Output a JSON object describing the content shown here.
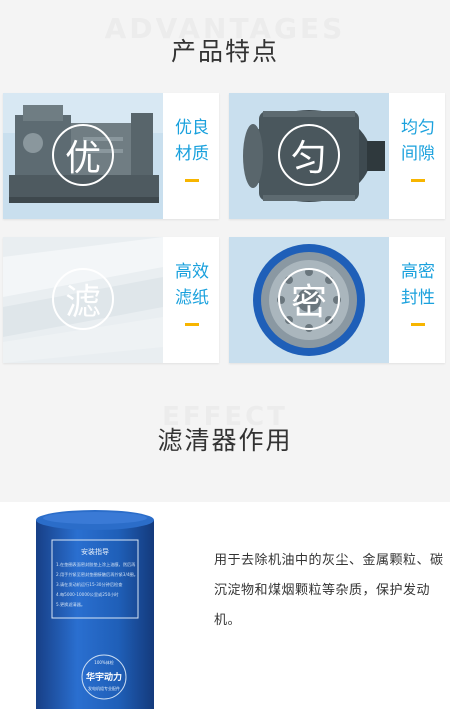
{
  "features_section": {
    "bg_word": "ADVANTAGES",
    "title": "产品特点"
  },
  "features": [
    {
      "circle_char": "优",
      "label_line1": "优良",
      "label_line2": "材质",
      "icon": "generator-photo"
    },
    {
      "circle_char": "匀",
      "label_line1": "均匀",
      "label_line2": "间隙",
      "icon": "alternator-photo"
    },
    {
      "circle_char": "滤",
      "label_line1": "高效",
      "label_line2": "滤纸",
      "icon": "filter-paper-photo"
    },
    {
      "circle_char": "密",
      "label_line1": "高密",
      "label_line2": "封性",
      "icon": "filter-seal-photo"
    }
  ],
  "effect_section": {
    "bg_word": "EFFECT",
    "title": "滤清器作用"
  },
  "product": {
    "description": "用于去除机油中的灰尘、金属颗粒、碳沉淀物和煤烟颗粒等杂质，保护发动机。",
    "filter_label_title": "安装指导",
    "filter_label_lines": [
      "1.在垫圈表面密封胶垫上涂上油膜，然后再",
      "2.用手拧紧至密封垫圈接触后再拧紧3/4圈。",
      "3.请在发动机运行15-30分钟后检查",
      "4.每5000-10000公里或250小时",
      "5.更换滤清器。"
    ],
    "brand_badge": "100%体检",
    "brand_name": "华宇动力",
    "brand_sub": "发电机组专业配件"
  },
  "colors": {
    "accent": "#1aa1dd",
    "bar": "#f7b500",
    "filter_blue": "#1f5fb8"
  }
}
